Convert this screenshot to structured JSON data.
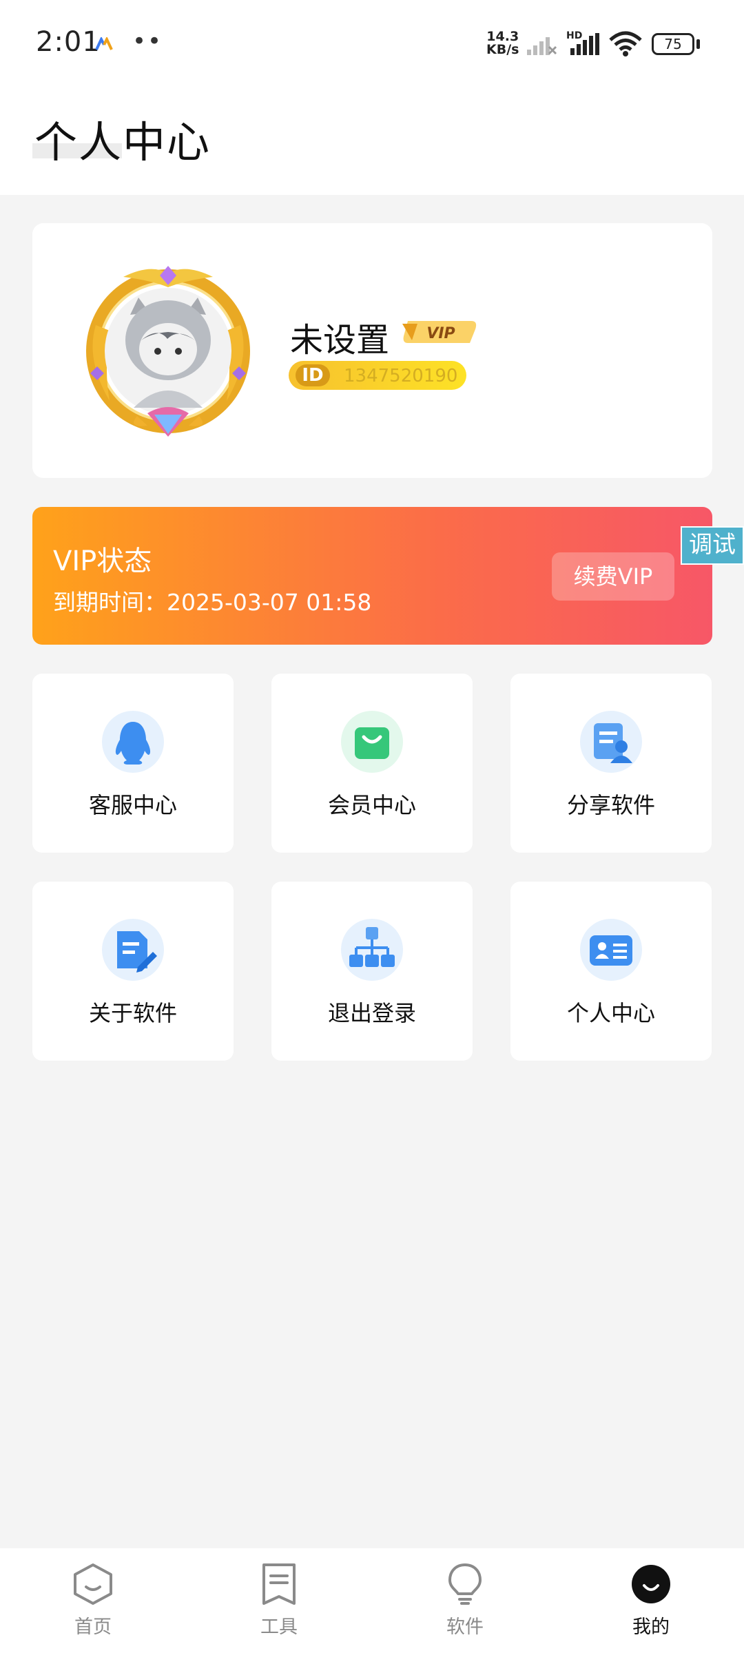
{
  "status_bar": {
    "time": "2:01",
    "dots": "••",
    "net_speed_value": "14.3",
    "net_speed_unit": "KB/s",
    "hd": "HD",
    "battery": "75"
  },
  "header": {
    "title": "个人中心"
  },
  "profile": {
    "username": "未设置",
    "vip_badge": "VIP",
    "id_icon": "ID",
    "id_number": "1347520190"
  },
  "vip_status": {
    "title": "VIP状态",
    "expiry": "到期时间：2025-03-07 01:58",
    "renew_label": "续费VIP"
  },
  "debug_tag": "调试",
  "grid": [
    {
      "label": "客服中心",
      "icon": "qq-penguin-icon"
    },
    {
      "label": "会员中心",
      "icon": "shopping-bag-icon"
    },
    {
      "label": "分享软件",
      "icon": "share-user-doc-icon"
    },
    {
      "label": "关于软件",
      "icon": "document-edit-icon"
    },
    {
      "label": "退出登录",
      "icon": "sitemap-icon"
    },
    {
      "label": "个人中心",
      "icon": "id-card-icon"
    }
  ],
  "bottom_nav": [
    {
      "label": "首页",
      "icon": "hexagon-icon",
      "active": false
    },
    {
      "label": "工具",
      "icon": "bookmark-list-icon",
      "active": false
    },
    {
      "label": "软件",
      "icon": "lightbulb-icon",
      "active": false
    },
    {
      "label": "我的",
      "icon": "smile-face-icon",
      "active": true
    }
  ],
  "colors": {
    "vip_gradient_start": "#ffa21a",
    "vip_gradient_end": "#f75767",
    "id_pill": "#fde226",
    "icon_blue": "#3d8ef0",
    "icon_green": "#36c77a",
    "debug_tag": "#4fb1cc"
  }
}
